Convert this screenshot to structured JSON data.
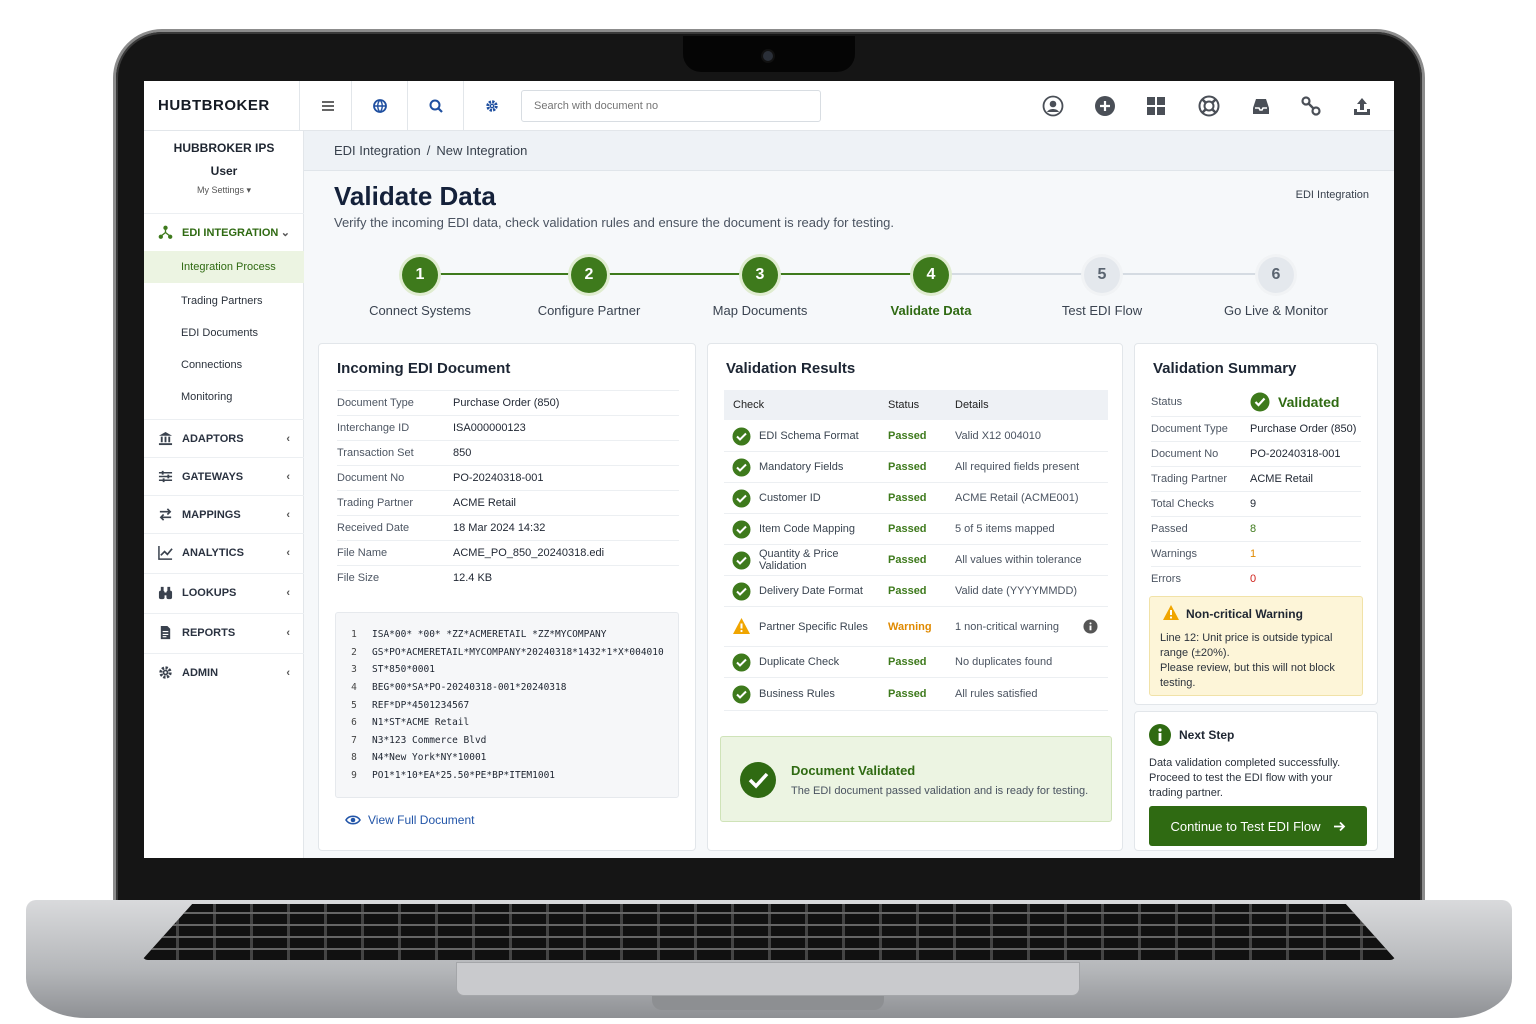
{
  "app": {
    "logo": "HUBTBROKER"
  },
  "topbar": {
    "search": {
      "placeholder": "Search with document no",
      "value": ""
    },
    "left_icons": [
      "menu-icon",
      "globe-icon",
      "search-icon",
      "gear-icon"
    ],
    "right_icons": [
      "user-circle-icon",
      "plus-circle-icon",
      "grid-icon",
      "lifebuoy-icon",
      "inbox-icon",
      "link-icon",
      "upload-icon"
    ]
  },
  "sidebar": {
    "org": "HUBBROKER IPS",
    "user": "User",
    "settings": "My Settings ▾",
    "active_group": "EDI INTEGRATION",
    "sub_items": [
      "Integration Process",
      "Trading Partners",
      "EDI Documents",
      "Connections",
      "Monitoring"
    ],
    "groups": [
      "ADAPTORS",
      "GATEWAYS",
      "MAPPINGS",
      "ANALYTICS",
      "LOOKUPS",
      "REPORTS",
      "ADMIN"
    ]
  },
  "breadcrumb": {
    "parent": "EDI Integration",
    "sep": "/",
    "current": "New Integration"
  },
  "header": {
    "title": "Validate Data",
    "subtitle": "Verify the incoming EDI data, check validation rules and ensure the document is ready for testing.",
    "right_link": "EDI Integration"
  },
  "steps": [
    {
      "num": "1",
      "label": "Connect Systems",
      "state": "done"
    },
    {
      "num": "2",
      "label": "Configure Partner",
      "state": "done"
    },
    {
      "num": "3",
      "label": "Map Documents",
      "state": "done"
    },
    {
      "num": "4",
      "label": "Validate Data",
      "state": "current"
    },
    {
      "num": "5",
      "label": "Test EDI Flow",
      "state": "todo"
    },
    {
      "num": "6",
      "label": "Go Live & Monitor",
      "state": "todo"
    }
  ],
  "incoming": {
    "title": "Incoming EDI Document",
    "rows": [
      {
        "k": "Document Type",
        "v": "Purchase Order (850)"
      },
      {
        "k": "Interchange ID",
        "v": "ISA000000123"
      },
      {
        "k": "Transaction Set",
        "v": "850"
      },
      {
        "k": "Document No",
        "v": "PO-20240318-001"
      },
      {
        "k": "Trading Partner",
        "v": "ACME Retail"
      },
      {
        "k": "Received Date",
        "v": "18 Mar 2024 14:32"
      },
      {
        "k": "File Name",
        "v": "ACME_PO_850_20240318.edi"
      },
      {
        "k": "File Size",
        "v": "12.4 KB"
      }
    ],
    "code": [
      {
        "n": "1",
        "t": "ISA*00* *00* *ZZ*ACMERETAIL    *ZZ*MYCOMPANY"
      },
      {
        "n": "2",
        "t": "GS*PO*ACMERETAIL*MYCOMPANY*20240318*1432*1*X*004010"
      },
      {
        "n": "3",
        "t": "ST*850*0001"
      },
      {
        "n": "4",
        "t": "BEG*00*SA*PO-20240318-001*20240318"
      },
      {
        "n": "5",
        "t": "REF*DP*4501234567"
      },
      {
        "n": "6",
        "t": "N1*ST*ACME Retail"
      },
      {
        "n": "7",
        "t": "N3*123 Commerce Blvd"
      },
      {
        "n": "8",
        "t": "N4*New York*NY*10001"
      },
      {
        "n": "9",
        "t": "PO1*1*10*EA*25.50*PE*BP*ITEM1001"
      }
    ],
    "view_full": "View Full Document"
  },
  "validation": {
    "title": "Validation Results",
    "headers": {
      "check": "Check",
      "status": "Status",
      "details": "Details"
    },
    "rows": [
      {
        "check": "EDI Schema Format",
        "status": "Passed",
        "details": "Valid X12 004010",
        "level": "ok"
      },
      {
        "check": "Mandatory Fields",
        "status": "Passed",
        "details": "All required fields present",
        "level": "ok"
      },
      {
        "check": "Customer ID",
        "status": "Passed",
        "details": "ACME Retail (ACME001)",
        "level": "ok"
      },
      {
        "check": "Item Code Mapping",
        "status": "Passed",
        "details": "5 of 5 items mapped",
        "level": "ok"
      },
      {
        "check": "Quantity & Price Validation",
        "status": "Passed",
        "details": "All values within tolerance",
        "level": "ok"
      },
      {
        "check": "Delivery Date Format",
        "status": "Passed",
        "details": "Valid date (YYYYMMDD)",
        "level": "ok"
      },
      {
        "check": "Partner Specific Rules",
        "status": "Warning",
        "details": "1 non-critical warning",
        "level": "warn"
      },
      {
        "check": "Duplicate Check",
        "status": "Passed",
        "details": "No duplicates found",
        "level": "ok"
      },
      {
        "check": "Business Rules",
        "status": "Passed",
        "details": "All rules satisfied",
        "level": "ok"
      }
    ],
    "banner": {
      "title": "Document Validated",
      "text": "The EDI document passed validation and is ready for testing."
    }
  },
  "summary": {
    "title": "Validation Summary",
    "status_label": "Status",
    "status_value": "Validated",
    "rows": [
      {
        "k": "Document Type",
        "v": "Purchase Order (850)",
        "color": "#1f2632"
      },
      {
        "k": "Document No",
        "v": "PO-20240318-001",
        "color": "#1f2632"
      },
      {
        "k": "Trading Partner",
        "v": "ACME Retail",
        "color": "#1f2632"
      },
      {
        "k": "Total Checks",
        "v": "9",
        "color": "#1f2632"
      },
      {
        "k": "Passed",
        "v": "8",
        "color": "#3e7a1c"
      },
      {
        "k": "Warnings",
        "v": "1",
        "color": "#e08a00"
      },
      {
        "k": "Errors",
        "v": "0",
        "color": "#d0201a"
      }
    ],
    "warning": {
      "title": "Non-critical Warning",
      "text1": "Line 12: Unit price is outside typical range (±20%).",
      "text2": "Please review, but this will not block testing."
    }
  },
  "next_step": {
    "title": "Next Step",
    "text": "Data validation completed successfully. Proceed to test the EDI flow with your trading partner.",
    "button": "Continue to Test EDI Flow"
  },
  "colors": {
    "accent": "#3e7a1c",
    "accent_dark": "#2f6a12",
    "warning": "#e08a00",
    "error": "#d0201a"
  }
}
